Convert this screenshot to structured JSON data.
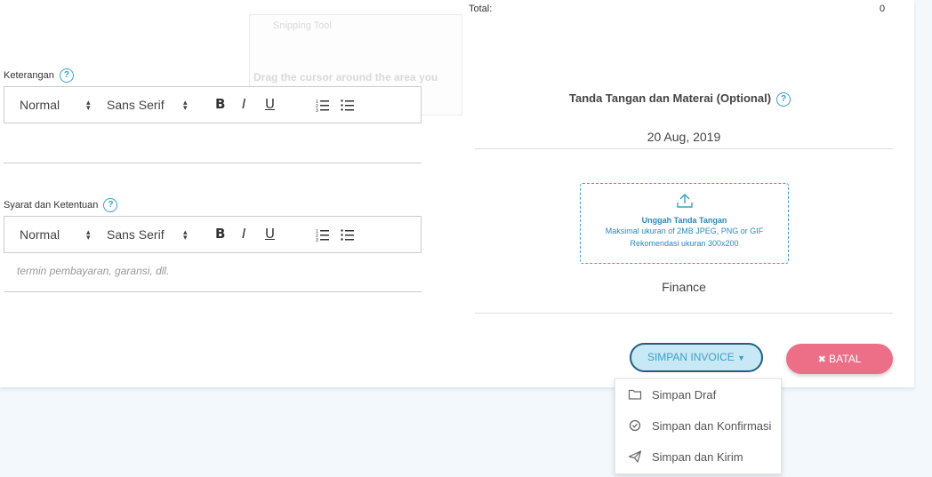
{
  "total": {
    "label": "Total:",
    "value": "0"
  },
  "overlay": {
    "title": "Snipping Tool",
    "text": "Drag the cursor around the area you want to capture."
  },
  "keterangan": {
    "label": "Keterangan",
    "help": "?",
    "toolbar": {
      "size": "Normal",
      "font": "Sans Serif",
      "bold": "B",
      "italic": "I",
      "underline": "U"
    },
    "content": ""
  },
  "syarat": {
    "label": "Syarat dan Ketentuan",
    "help": "?",
    "toolbar": {
      "size": "Normal",
      "font": "Sans Serif",
      "bold": "B",
      "italic": "I",
      "underline": "U"
    },
    "placeholder": "termin pembayaran, garansi, dll."
  },
  "signature": {
    "title": "Tanda Tangan dan Materai (Optional)",
    "help": "?",
    "date": "20 Aug, 2019",
    "upload_title": "Unggah Tanda Tangan",
    "upload_max": "Maksimal ukuran of 2MB JPEG, PNG or GIF",
    "upload_rec": "Rekomendasi ukuran 300x200",
    "name": "Finance"
  },
  "actions": {
    "save_label": "SIMPAN INVOICE",
    "cancel_label": "BATAL",
    "menu": [
      {
        "label": "Simpan Draf",
        "icon": "folder-icon"
      },
      {
        "label": "Simpan dan Konfirmasi",
        "icon": "check-circle-icon"
      },
      {
        "label": "Simpan dan Kirim",
        "icon": "paper-plane-icon"
      }
    ]
  },
  "colors": {
    "accent": "#3aa0c8",
    "cancel": "#ec6f87",
    "save_bg": "#c9e8f5",
    "page_bg": "#f3f8fc"
  }
}
